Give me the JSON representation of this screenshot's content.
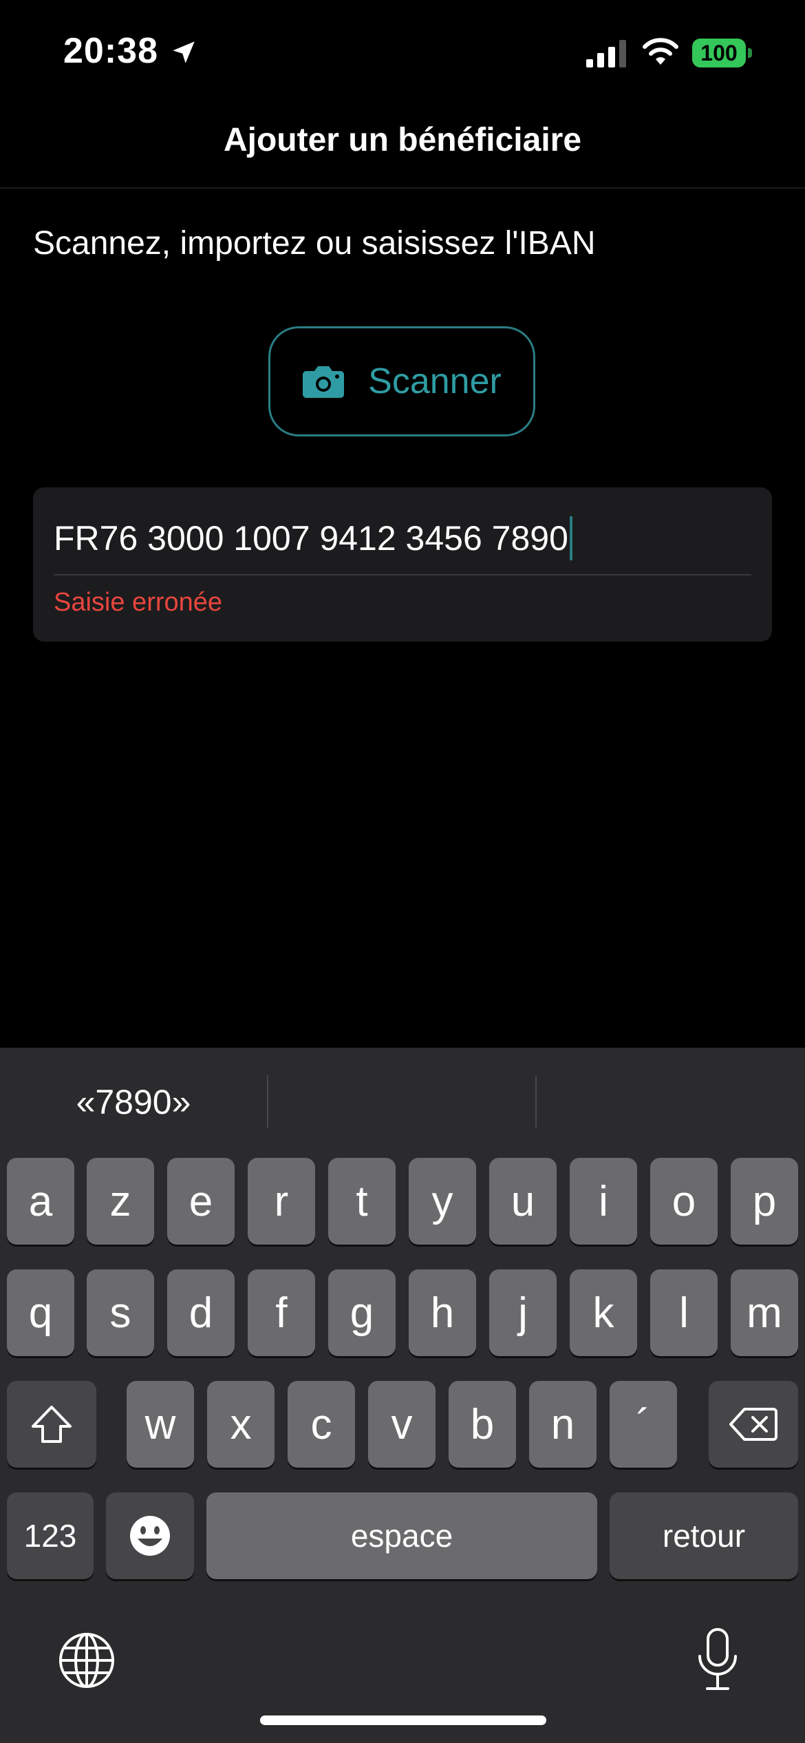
{
  "status_bar": {
    "time": "20:38",
    "battery": "100",
    "icons": [
      "location-arrow-icon",
      "cellular-signal-icon",
      "wifi-icon",
      "battery-icon"
    ],
    "battery_color": "#34c759"
  },
  "nav": {
    "title": "Ajouter un bénéficiaire"
  },
  "form": {
    "instruction": "Scannez, importez ou saisissez l'IBAN",
    "scan_button": {
      "label": "Scanner",
      "icon": "camera-icon",
      "accent": "#2f9ca3"
    },
    "iban": {
      "value": "FR76 3000 1007 9412 3456 7890",
      "error": "Saisie erronée",
      "error_color": "#e8463e"
    }
  },
  "keyboard": {
    "suggestions": [
      "«7890»",
      "",
      ""
    ],
    "row1": [
      "a",
      "z",
      "e",
      "r",
      "t",
      "y",
      "u",
      "i",
      "o",
      "p"
    ],
    "row2": [
      "q",
      "s",
      "d",
      "f",
      "g",
      "h",
      "j",
      "k",
      "l",
      "m"
    ],
    "row3": [
      "w",
      "x",
      "c",
      "v",
      "b",
      "n",
      "´"
    ],
    "numbers_key": "123",
    "space_key": "espace",
    "return_key": "retour",
    "icons": [
      "shift-icon",
      "backspace-icon",
      "emoji-icon",
      "globe-icon",
      "microphone-icon"
    ]
  }
}
